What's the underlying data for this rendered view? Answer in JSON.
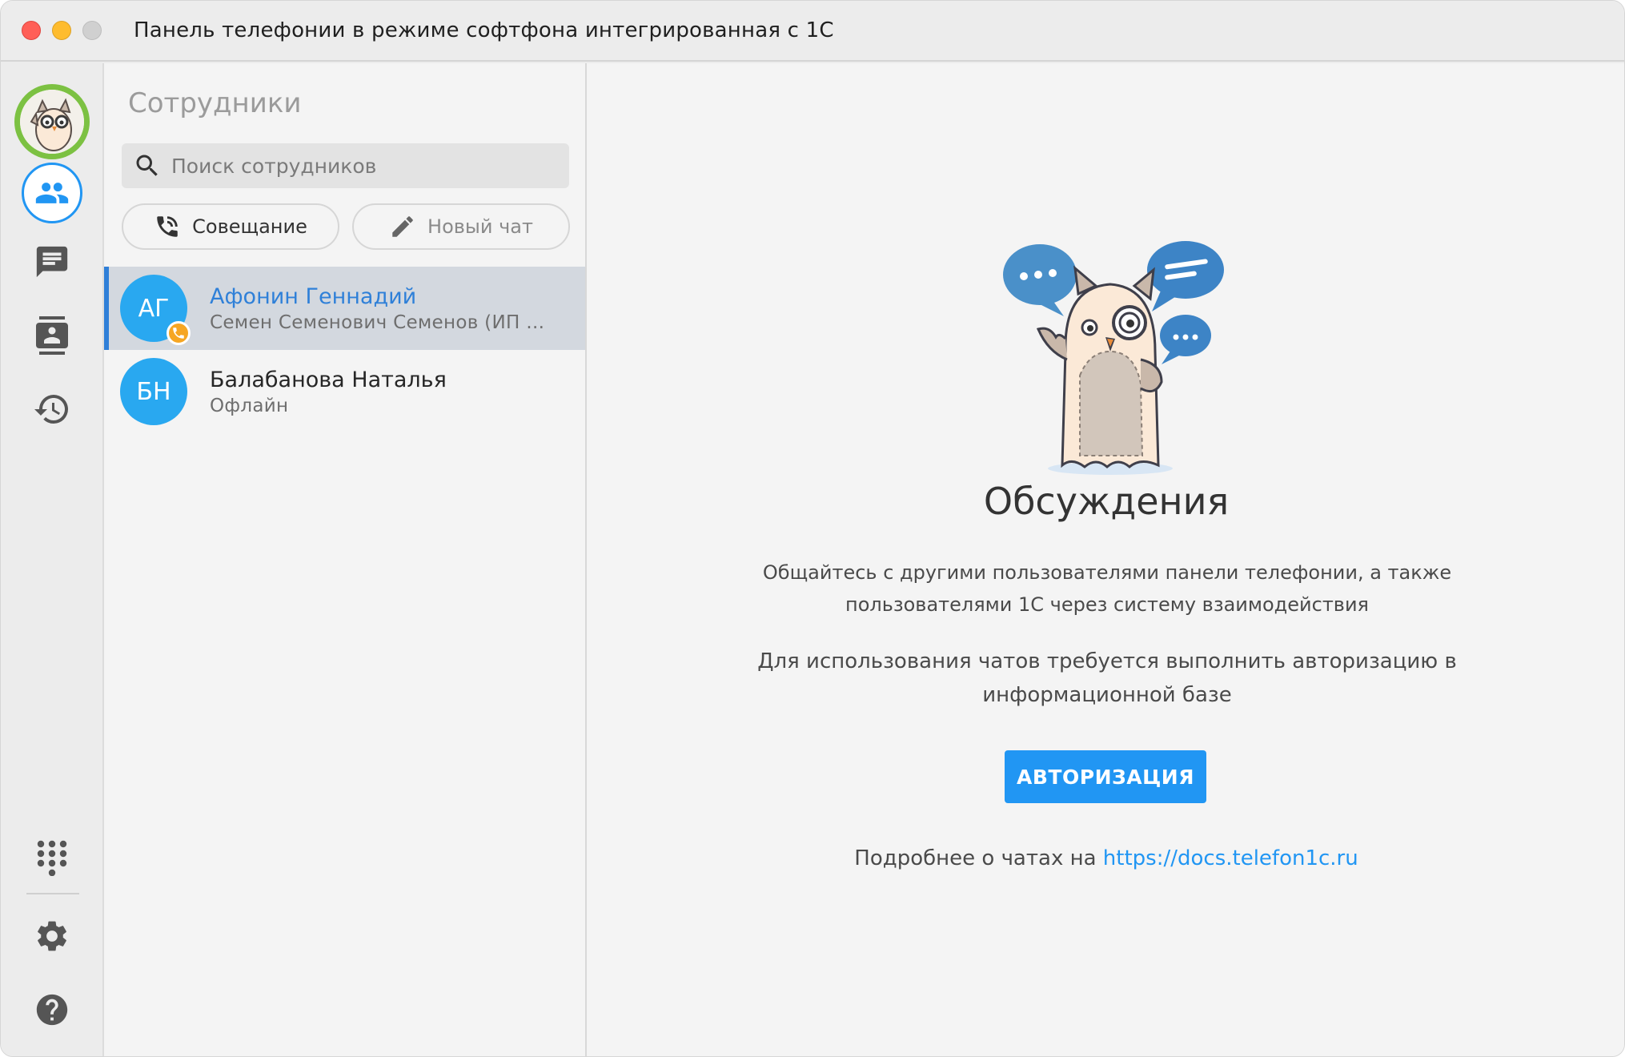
{
  "window": {
    "title": "Панель телефонии в режиме софтфона интегрированная с 1С"
  },
  "rail": {
    "items": [
      {
        "name": "employees",
        "icon": "people-icon",
        "active": true
      },
      {
        "name": "chats",
        "icon": "chat-icon"
      },
      {
        "name": "contacts",
        "icon": "contacts-icon"
      },
      {
        "name": "history",
        "icon": "history-icon"
      },
      {
        "name": "dialpad",
        "icon": "dialpad-icon"
      },
      {
        "name": "settings",
        "icon": "gear-icon"
      },
      {
        "name": "help",
        "icon": "help-icon"
      }
    ]
  },
  "panel": {
    "title": "Сотрудники",
    "search_placeholder": "Поиск сотрудников",
    "meeting_label": "Совещание",
    "new_chat_label": "Новый чат",
    "employees": [
      {
        "initials": "АГ",
        "name": "Афонин Геннадий",
        "sub": "Семен Семенович Семенов (ИП …",
        "status": "on-call"
      },
      {
        "initials": "БН",
        "name": "Балабанова Наталья",
        "sub": "Офлайн",
        "status": "offline"
      }
    ]
  },
  "main": {
    "title": "Обсуждения",
    "desc1_line1": "Общайтесь с другими пользователями панели телефонии, а также",
    "desc1_line2": "пользователями 1С через систему взаимодействия",
    "desc2_line1": "Для использования чатов требуется выполнить авторизацию в",
    "desc2_line2": "информационной базе",
    "auth_button": "АВТОРИЗАЦИЯ",
    "more_prefix": "Подробнее о чатах на ",
    "more_link": "https://docs.telefon1c.ru"
  },
  "colors": {
    "accent": "#2196f3",
    "avatar_ring": "#7cc142",
    "employee_avatar": "#29a8f0",
    "status_on_call": "#f6a623",
    "selected_row": "#d3d8df"
  }
}
